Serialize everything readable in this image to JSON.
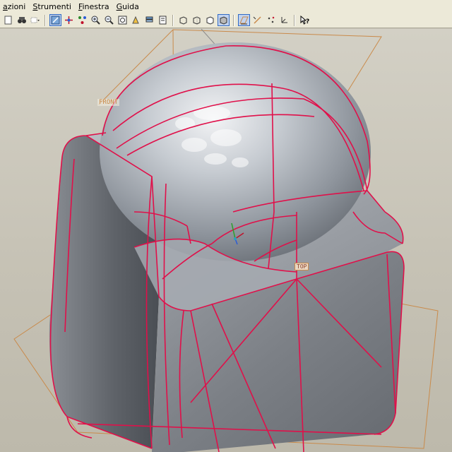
{
  "menubar": {
    "items": [
      {
        "label": "azioni",
        "key": "a"
      },
      {
        "label": "Strumenti",
        "key": "S"
      },
      {
        "label": "Finestra",
        "key": "F"
      },
      {
        "label": "Guida",
        "key": "G"
      }
    ]
  },
  "toolbar": {
    "icons": [
      "new-file-icon",
      "binoculars-icon",
      "dropdown-icon",
      "repaint-icon",
      "spin-center-icon",
      "orient-icon",
      "zoom-in-icon",
      "zoom-out-icon",
      "refit-icon",
      "view-manager-icon",
      "layers-icon",
      "saved-views-icon",
      "wireframe-icon",
      "hidden-line-icon",
      "no-hidden-icon",
      "shading-icon",
      "datum-planes-icon",
      "datum-axes-icon",
      "datum-points-icon",
      "csys-icon",
      "context-help-icon"
    ],
    "help_label": "?"
  },
  "viewport": {
    "datum_front_label": "FRONT",
    "datum_top_label": "TOP"
  },
  "colors": {
    "edge": "#e0104a",
    "datum": "#c98a4a",
    "toolbar_bg": "#ece9d8"
  }
}
